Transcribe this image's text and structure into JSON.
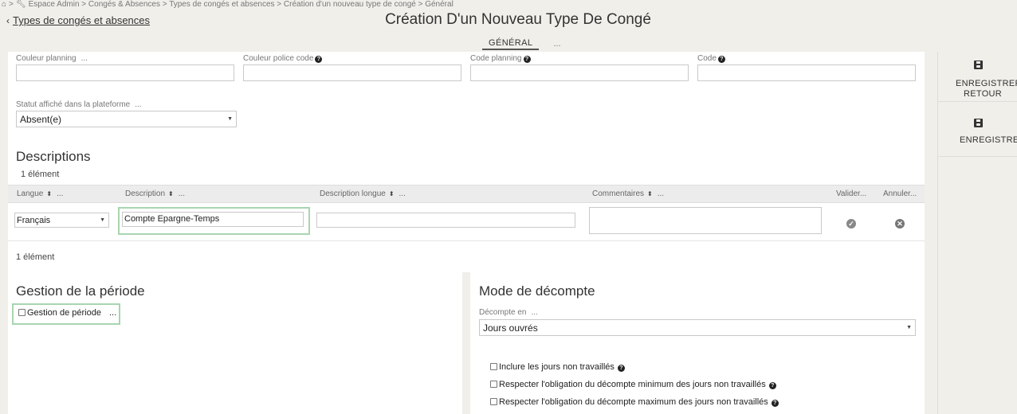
{
  "breadcrumb": {
    "home_icon": "home-icon",
    "separator": ">",
    "tools_icon": "wrench-icon",
    "path": "Espace Admin > Congés & Absences > Types de congés et absences > Création d'un nouveau type de congé > Général"
  },
  "back": {
    "label": "Types de congés et absences"
  },
  "title": "Création D'un Nouveau Type De Congé",
  "tabs": [
    {
      "label": "GÉNÉRAL",
      "active": true
    },
    {
      "label": "...",
      "active": false
    }
  ],
  "fields": {
    "couleur_planning": {
      "label": "Couleur planning",
      "more": "...",
      "value": ""
    },
    "couleur_police": {
      "label": "Couleur police code",
      "value": ""
    },
    "code_planning": {
      "label": "Code planning",
      "value": ""
    },
    "code": {
      "label": "Code",
      "value": ""
    },
    "statut": {
      "label": "Statut affiché dans la plateforme",
      "more": "...",
      "value": "Absent(e)"
    }
  },
  "descriptions": {
    "title": "Descriptions",
    "count_top": "1 élément",
    "count_bottom": "1 élément",
    "columns": {
      "langue": "Langue",
      "description": "Description",
      "description_longue": "Description longue",
      "commentaires": "Commentaires",
      "valider": "Valider...",
      "annuler": "Annuler...",
      "more": "..."
    },
    "row": {
      "langue": "Français",
      "description": "Compte Epargne-Temps",
      "description_longue": "",
      "commentaires": ""
    }
  },
  "periode": {
    "title": "Gestion de la période",
    "checkbox_label": "Gestion de période",
    "more": "..."
  },
  "decompte": {
    "title": "Mode de décompte",
    "label": "Décompte en",
    "more": "...",
    "value": "Jours ouvrés",
    "options": [
      "Inclure les jours non travaillés",
      "Respecter l'obligation du décompte minimum des jours non travaillés",
      "Respecter l'obligation du décompte maximum des jours non travaillés"
    ]
  },
  "rail": {
    "save_return_line1": "ENREGISTRER",
    "save_return_line2": "RETOUR",
    "save": "ENREGISTRER"
  },
  "help_glyph": "?"
}
